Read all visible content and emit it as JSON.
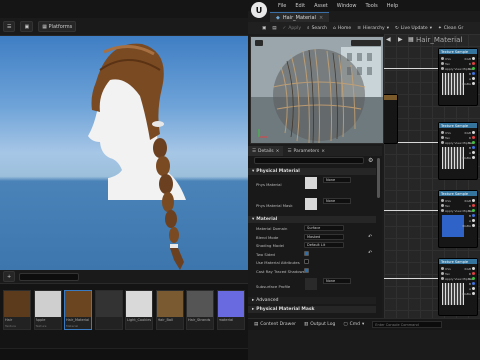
{
  "left": {
    "platforms_label": "Platforms",
    "icon_names": [
      "hamburger-icon",
      "camera-icon",
      "platforms-icon"
    ]
  },
  "content_browser": {
    "assets": [
      {
        "name": "Hair",
        "type": "Texture",
        "color": "#5c3a1c"
      },
      {
        "name": "Apple",
        "type": "Texture",
        "color": "#cfcfcf"
      },
      {
        "name": "Hair_Material",
        "type": "Material",
        "color": "#6b4520"
      },
      {
        "name": "",
        "type": "",
        "color": "#333333"
      },
      {
        "name": "Light_Cookies",
        "type": "",
        "color": "#d9d9d9"
      },
      {
        "name": "Hair_Ball",
        "type": "",
        "color": "#7a5a30"
      },
      {
        "name": "Hair_Strands",
        "type": "",
        "color": "#555555"
      },
      {
        "name": "material",
        "type": "",
        "color": "#6a6ae0"
      }
    ]
  },
  "editor": {
    "logo": "U",
    "menu": [
      "File",
      "Edit",
      "Asset",
      "Window",
      "Tools",
      "Help"
    ],
    "tab_title": "Hair_Material",
    "toolbar": {
      "save": "Save",
      "browse": "",
      "apply": "Apply",
      "search": "Search",
      "home": "Home",
      "hierarchy": "Hierarchy",
      "live_update": "Live Update",
      "clean_graph": "Clean Gr"
    },
    "details": {
      "tab_details": "Details",
      "tab_parameters": "Parameters",
      "sections": {
        "physical_material": "Physical Material",
        "material": "Material",
        "advanced": "Advanced",
        "physical_material_mask": "Physical Material Mask"
      },
      "props": {
        "phys_material": "Phys Material",
        "phys_material_mask": "Phys Material Mask",
        "material_domain": "Material Domain",
        "blend_mode": "Blend Mode",
        "shading_model": "Shading Model",
        "two_sided": "Two Sided",
        "use_material_attributes": "Use Material Attributes",
        "cast_ray_traced_shadows": "Cast Ray Traced Shadows",
        "subsurface_profile": "Subsurface Profile"
      },
      "values": {
        "none": "None",
        "domain": "Surface",
        "blend": "Masked",
        "shading": "Default Lit"
      },
      "swatch_label": "None"
    },
    "graph": {
      "title": "Hair_Material",
      "node_header": "Texture Sample",
      "pins": [
        "UVs",
        "Tex",
        "Apply View MipBias",
        "RGB",
        "R",
        "G",
        "B",
        "A",
        "RGBA"
      ]
    },
    "bottom": {
      "content_drawer": "Content Drawer",
      "output_log": "Output Log",
      "cmd": "Cmd",
      "cmd_placeholder": "Enter Console Command"
    }
  }
}
